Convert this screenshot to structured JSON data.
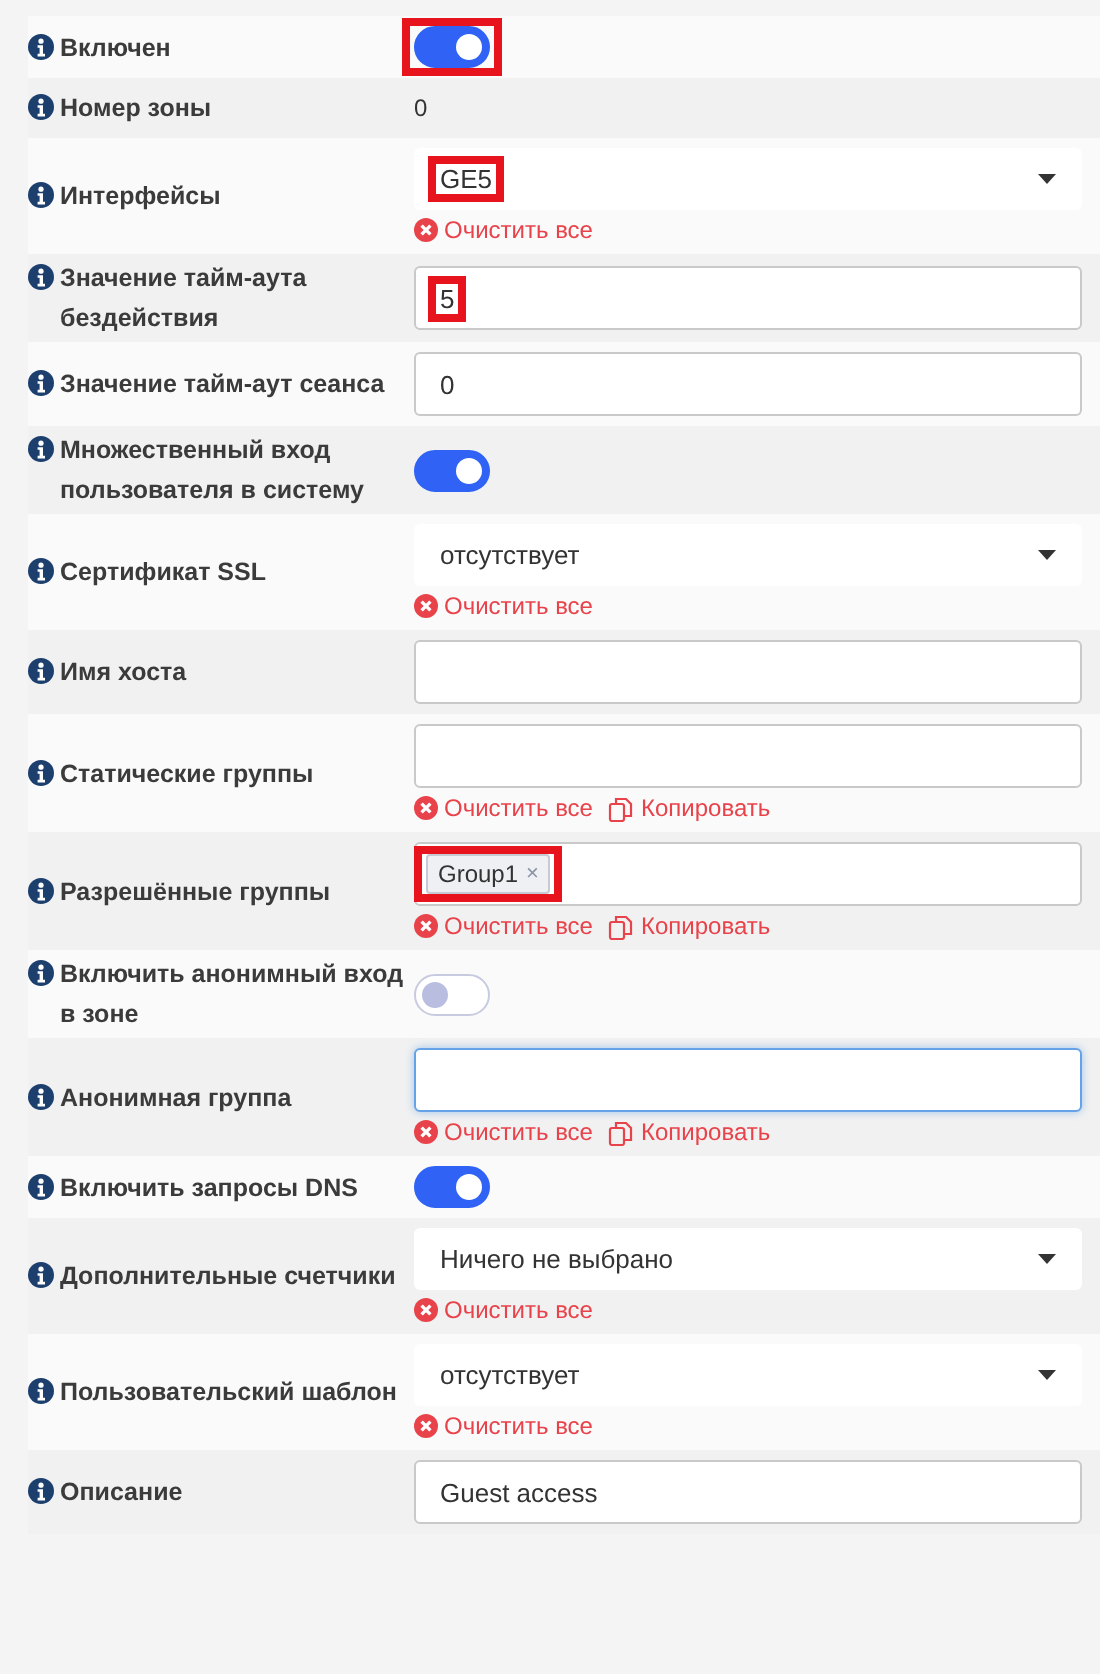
{
  "rows": [
    {
      "kind": "toggle",
      "label": "Включен",
      "on": true,
      "highlighted": true
    },
    {
      "kind": "static",
      "label": "Номер зоны",
      "value": "0"
    },
    {
      "kind": "select",
      "label": "Интерфейсы",
      "value": "GE5",
      "highlighted": true,
      "actions": [
        {
          "kind": "clear",
          "label": "Очистить все"
        }
      ]
    },
    {
      "kind": "input",
      "label": "Значение тайм-аута бездействия",
      "value": "5",
      "highlighted": true
    },
    {
      "kind": "input",
      "label": "Значение тайм-аут сеанса",
      "value": "0"
    },
    {
      "kind": "toggle",
      "label": "Множественный вход пользователя в систему",
      "on": true
    },
    {
      "kind": "select",
      "label": "Сертификат SSL",
      "value": "отсутствует",
      "actions": [
        {
          "kind": "clear",
          "label": "Очистить все"
        }
      ]
    },
    {
      "kind": "input",
      "label": "Имя хоста"
    },
    {
      "kind": "tags",
      "label": "Статические группы",
      "actions": [
        {
          "kind": "clear",
          "label": "Очистить все"
        },
        {
          "kind": "copy",
          "label": "Копировать"
        }
      ]
    },
    {
      "kind": "tags",
      "label": "Разрешённые группы",
      "tags": [
        {
          "label": "Group1",
          "remove": "×"
        }
      ],
      "highlighted": true,
      "actions": [
        {
          "kind": "clear",
          "label": "Очистить все"
        },
        {
          "kind": "copy",
          "label": "Копировать"
        }
      ]
    },
    {
      "kind": "toggle",
      "label": "Включить анонимный вход в зоне",
      "on": false
    },
    {
      "kind": "tags",
      "label": "Анонимная группа",
      "focused": true,
      "actions": [
        {
          "kind": "clear",
          "label": "Очистить все"
        },
        {
          "kind": "copy",
          "label": "Копировать"
        }
      ]
    },
    {
      "kind": "toggle",
      "label": "Включить запросы DNS",
      "on": true
    },
    {
      "kind": "select",
      "label": "Дополнительные счетчики",
      "value": "Ничего не выбрано",
      "actions": [
        {
          "kind": "clear",
          "label": "Очистить все"
        }
      ]
    },
    {
      "kind": "select",
      "label": "Пользовательский шаблон",
      "value": "отсутствует",
      "actions": [
        {
          "kind": "clear",
          "label": "Очистить все"
        }
      ]
    },
    {
      "kind": "input",
      "label": "Описание",
      "value": "Guest access"
    }
  ]
}
